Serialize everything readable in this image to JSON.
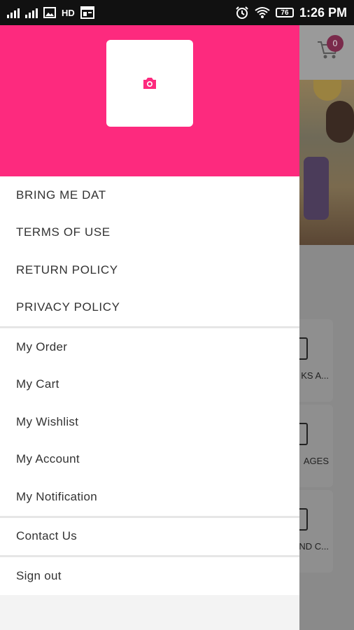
{
  "status_bar": {
    "network_label": "HD",
    "battery": "76",
    "time": "1:26 PM"
  },
  "background_app": {
    "cart_count": "0",
    "card_labels": [
      "KS A...",
      "AGES",
      "ND C..."
    ]
  },
  "drawer": {
    "avatar_icon": "camera-icon",
    "accent_color": "#fd2a7e",
    "menu_group_1": [
      "BRING ME DAT",
      "TERMS OF USE",
      "RETURN POLICY",
      "PRIVACY POLICY"
    ],
    "menu_group_2": [
      "My Order",
      "My Cart",
      "My Wishlist",
      "My Account",
      "My Notification"
    ],
    "menu_group_3": [
      "Contact Us"
    ],
    "menu_group_4": [
      "Sign out"
    ]
  }
}
